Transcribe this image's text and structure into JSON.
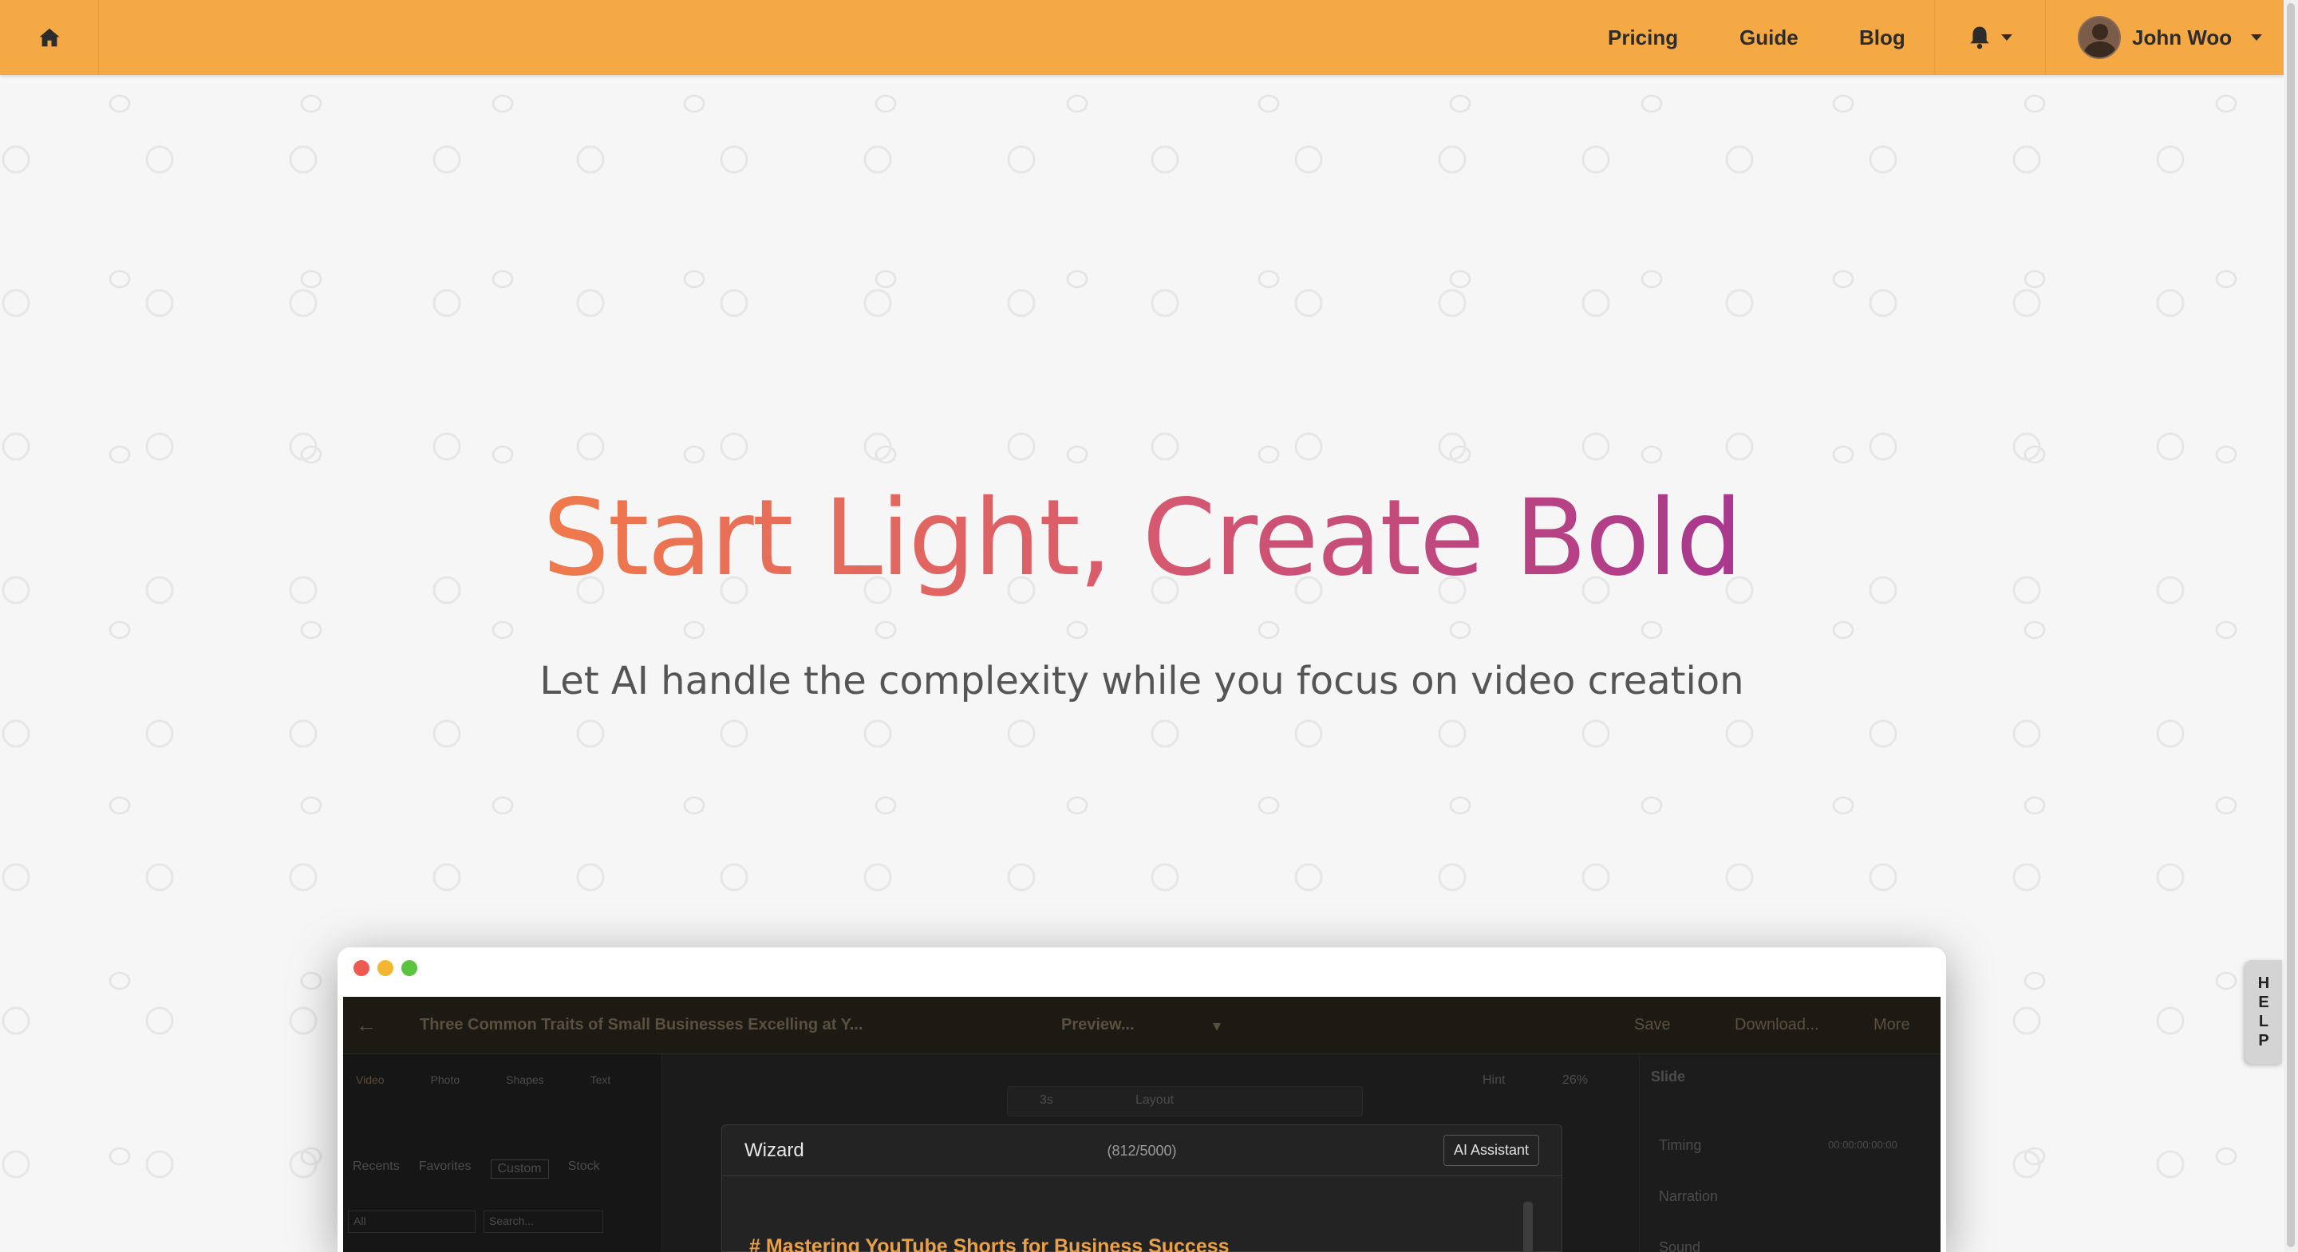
{
  "nav": {
    "links": [
      "Pricing",
      "Guide",
      "Blog"
    ],
    "user_name": "John Woo"
  },
  "hero": {
    "title": "Start Light, Create Bold",
    "subtitle": "Let AI handle the complexity while you focus on video creation"
  },
  "preview": {
    "project_title": "Three Common Traits of Small Businesses Excelling at Y...",
    "preview_label": "Preview...",
    "save_label": "Save",
    "download_label": "Download...",
    "more_label": "More",
    "hint_label": "Hint",
    "zoom_label": "26%",
    "duration_label": "3s",
    "layout_label": "Layout",
    "left_tabs": [
      "Video",
      "Photo",
      "Shapes",
      "Text"
    ],
    "media_tabs": [
      "Recents",
      "Favorites",
      "Custom",
      "Stock"
    ],
    "media_filter": "All",
    "media_search_placeholder": "Search...",
    "right_panel": {
      "title": "Slide",
      "items": [
        "Timing",
        "Narration",
        "Sound"
      ],
      "timing_value": "00:00:00:00:00"
    },
    "wizard": {
      "title": "Wizard",
      "count": "(812/5000)",
      "ai_button": "AI Assistant",
      "heading": "# Mastering YouTube Shorts for Business Success"
    }
  },
  "help": {
    "letters": [
      "H",
      "E",
      "L",
      "P"
    ]
  },
  "colors": {
    "nav_bg": "#f4a944",
    "gradient_start": "#f07a4b",
    "gradient_end": "#a8378f",
    "wizard_accent": "#e9a04a"
  }
}
